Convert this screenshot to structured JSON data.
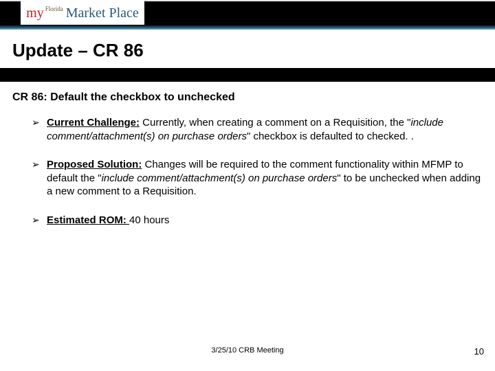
{
  "logo": {
    "my": "my",
    "florida": "Florida",
    "market": "Market Place"
  },
  "slide_title": "Update – CR 86",
  "subheading": "CR 86:  Default the checkbox to unchecked",
  "bullets": [
    {
      "label": "Current Challenge:",
      "pre": "  Currently, when creating a comment on a Requisition, the \"",
      "italic": "include comment/attachment(s) on purchase orders",
      "post": "\" checkbox is defaulted to checked. ."
    },
    {
      "label": "Proposed Solution:",
      "pre": " Changes will be required to the comment functionality within MFMP to default the \"",
      "italic": "include comment/attachment(s) on purchase orders",
      "post": "\" to be unchecked when adding a new comment to a Requisition."
    },
    {
      "label": "Estimated ROM: ",
      "pre": "  40 hours",
      "italic": "",
      "post": ""
    }
  ],
  "footer": {
    "center": "3/25/10 CRB Meeting",
    "page": "10"
  }
}
